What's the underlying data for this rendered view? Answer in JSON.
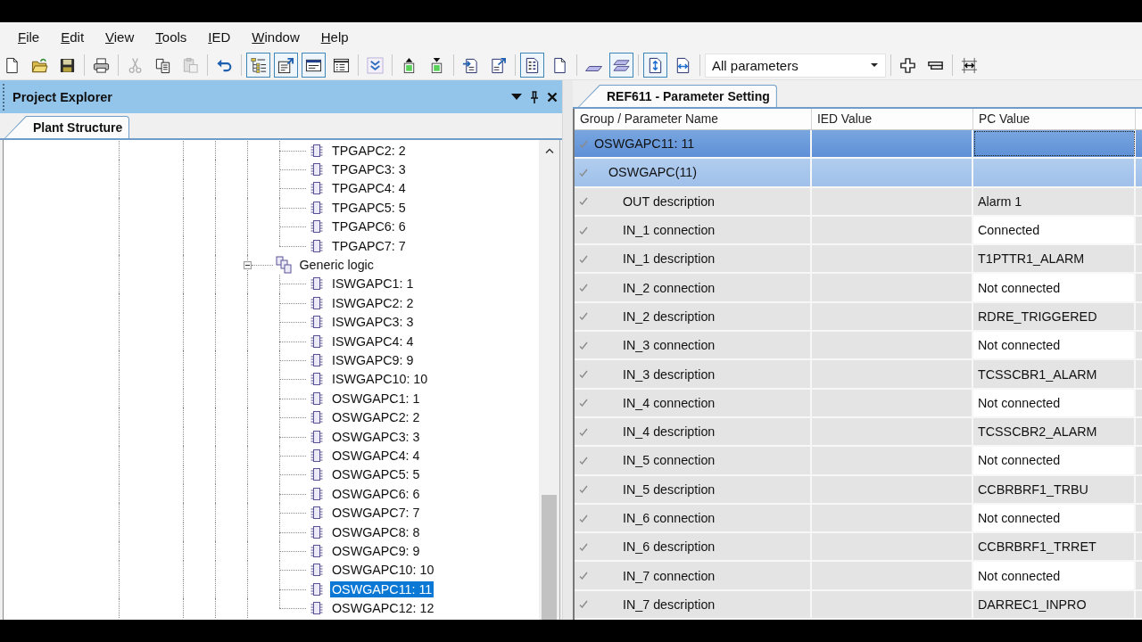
{
  "menu": [
    "File",
    "Edit",
    "View",
    "Tools",
    "IED",
    "Window",
    "Help"
  ],
  "toolbar": {
    "groups": [
      {
        "kind": "buttons",
        "buttons": [
          {
            "pressed": false,
            "disabled": false
          },
          {
            "pressed": false,
            "disabled": false
          },
          {
            "pressed": false,
            "disabled": false
          }
        ]
      },
      {
        "kind": "buttons",
        "buttons": [
          {
            "pressed": false,
            "disabled": false
          }
        ]
      },
      {
        "kind": "buttons",
        "buttons": [
          {
            "pressed": false,
            "disabled": true
          },
          {
            "pressed": false,
            "disabled": false
          },
          {
            "pressed": false,
            "disabled": true
          }
        ]
      },
      {
        "kind": "buttons",
        "buttons": [
          {
            "pressed": false,
            "disabled": false
          }
        ]
      },
      {
        "kind": "buttons",
        "buttons": [
          {
            "pressed": true,
            "disabled": false
          },
          {
            "pressed": true,
            "disabled": false
          },
          {
            "pressed": true,
            "disabled": false
          },
          {
            "pressed": false,
            "disabled": false
          }
        ]
      },
      {
        "kind": "buttons",
        "buttons": [
          {
            "pressed": false,
            "disabled": false
          }
        ]
      },
      {
        "kind": "buttons",
        "buttons": [
          {
            "pressed": false,
            "disabled": false
          },
          {
            "pressed": false,
            "disabled": false
          }
        ]
      },
      {
        "kind": "buttons",
        "buttons": [
          {
            "pressed": false,
            "disabled": false
          },
          {
            "pressed": false,
            "disabled": false
          }
        ]
      },
      {
        "kind": "buttons",
        "buttons": [
          {
            "pressed": true,
            "disabled": false
          },
          {
            "pressed": false,
            "disabled": false
          }
        ]
      },
      {
        "kind": "buttons",
        "buttons": [
          {
            "pressed": false,
            "disabled": false
          },
          {
            "pressed": true,
            "disabled": false
          }
        ]
      },
      {
        "kind": "buttons",
        "buttons": [
          {
            "pressed": true,
            "disabled": false
          },
          {
            "pressed": false,
            "disabled": false
          }
        ]
      },
      {
        "kind": "dropdown",
        "value": "All parameters"
      },
      {
        "kind": "buttons",
        "buttons": [
          {
            "pressed": false,
            "disabled": false
          },
          {
            "pressed": false,
            "disabled": false
          }
        ]
      },
      {
        "kind": "buttons",
        "buttons": [
          {
            "pressed": false,
            "disabled": false
          }
        ]
      }
    ]
  },
  "explorer": {
    "title": "Project Explorer",
    "tabs": [
      {
        "label": "Plant Structure",
        "selected": true
      }
    ],
    "tree": [
      {
        "children": [
          {
            "label": "TPGAPC2: 2",
            "selected": false
          },
          {
            "label": "TPGAPC3: 3",
            "selected": false
          },
          {
            "label": "TPGAPC4: 4",
            "selected": false
          },
          {
            "label": "TPGAPC5: 5",
            "selected": false
          },
          {
            "label": "TPGAPC6: 6",
            "selected": false
          },
          {
            "label": "TPGAPC7: 7",
            "selected": false
          }
        ]
      },
      {
        "label": "Generic logic",
        "expanded": true,
        "selected": false,
        "children": [
          {
            "label": "ISWGAPC1: 1",
            "selected": false
          },
          {
            "label": "ISWGAPC2: 2",
            "selected": false
          },
          {
            "label": "ISWGAPC3: 3",
            "selected": false
          },
          {
            "label": "ISWGAPC4: 4",
            "selected": false
          },
          {
            "label": "ISWGAPC9: 9",
            "selected": false
          },
          {
            "label": "ISWGAPC10: 10",
            "selected": false
          },
          {
            "label": "OSWGAPC1: 1",
            "selected": false
          },
          {
            "label": "OSWGAPC2: 2",
            "selected": false
          },
          {
            "label": "OSWGAPC3: 3",
            "selected": false
          },
          {
            "label": "OSWGAPC4: 4",
            "selected": false
          },
          {
            "label": "OSWGAPC5: 5",
            "selected": false
          },
          {
            "label": "OSWGAPC6: 6",
            "selected": false
          },
          {
            "label": "OSWGAPC7: 7",
            "selected": false
          },
          {
            "label": "OSWGAPC8: 8",
            "selected": false
          },
          {
            "label": "OSWGAPC9: 9",
            "selected": false
          },
          {
            "label": "OSWGAPC10: 10",
            "selected": false
          },
          {
            "label": "OSWGAPC11: 11",
            "selected": true
          },
          {
            "label": "OSWGAPC12: 12",
            "selected": false
          }
        ]
      }
    ]
  },
  "editor": {
    "tabs": [
      {
        "label": "REF611 - Parameter Setting",
        "selected": true
      }
    ],
    "table": {
      "columns": [
        "Group / Parameter Name",
        "IED Value",
        "PC Value"
      ],
      "rows": [
        {
          "name": "OSWGAPC11: 11",
          "selected": true,
          "children": [
            {
              "name": "OSWGAPC(11)",
              "selected": false,
              "children": [
                {
                  "name": "OUT description",
                  "pc_value": "Alarm 1",
                  "pc_value_field": false,
                  "selected": false
                },
                {
                  "name": "IN_1 connection",
                  "pc_value": "Connected",
                  "pc_value_field": true,
                  "selected": false
                },
                {
                  "name": "IN_1 description",
                  "pc_value": "T1PTTR1_ALARM",
                  "pc_value_field": false,
                  "selected": false
                },
                {
                  "name": "IN_2 connection",
                  "pc_value": "Not connected",
                  "pc_value_field": true,
                  "selected": false
                },
                {
                  "name": "IN_2 description",
                  "pc_value": "RDRE_TRIGGERED",
                  "pc_value_field": false,
                  "selected": false
                },
                {
                  "name": "IN_3 connection",
                  "pc_value": "Not connected",
                  "pc_value_field": true,
                  "selected": false
                },
                {
                  "name": "IN_3 description",
                  "pc_value": "TCSSCBR1_ALARM",
                  "pc_value_field": false,
                  "selected": false
                },
                {
                  "name": "IN_4 connection",
                  "pc_value": "Not connected",
                  "pc_value_field": true,
                  "selected": false
                },
                {
                  "name": "IN_4 description",
                  "pc_value": "TCSSCBR2_ALARM",
                  "pc_value_field": false,
                  "selected": false
                },
                {
                  "name": "IN_5 connection",
                  "pc_value": "Not connected",
                  "pc_value_field": true,
                  "selected": false
                },
                {
                  "name": "IN_5 description",
                  "pc_value": "CCBRBRF1_TRBU",
                  "pc_value_field": false,
                  "selected": false
                },
                {
                  "name": "IN_6 connection",
                  "pc_value": "Not connected",
                  "pc_value_field": true,
                  "selected": false
                },
                {
                  "name": "IN_6 description",
                  "pc_value": "CCBRBRF1_TRRET",
                  "pc_value_field": false,
                  "selected": false
                },
                {
                  "name": "IN_7 connection",
                  "pc_value": "Not connected",
                  "pc_value_field": true,
                  "selected": false
                },
                {
                  "name": "IN_7 description",
                  "pc_value": "DARREC1_INPRO",
                  "pc_value_field": false,
                  "selected": false
                }
              ]
            }
          ]
        }
      ]
    }
  }
}
